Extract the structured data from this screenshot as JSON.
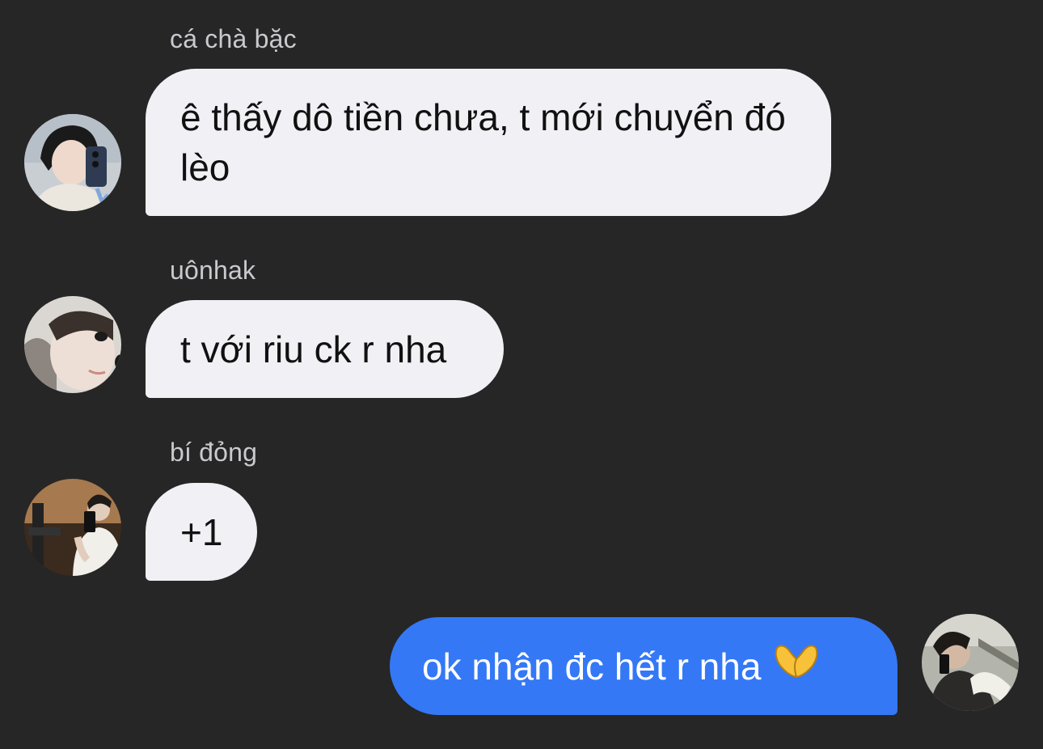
{
  "messages": [
    {
      "sender": "cá chà bặc",
      "text": "ê thấy dô tiền chưa, t mới chuyển đó lèo",
      "direction": "incoming"
    },
    {
      "sender": "uônhak",
      "text": "t với riu ck r nha",
      "direction": "incoming"
    },
    {
      "sender": "bí đỏng",
      "text": "+1",
      "direction": "incoming"
    },
    {
      "sender": "",
      "text": "ok nhận đc hết r nha",
      "emoji": "heart-hands-emoji",
      "direction": "outgoing"
    }
  ],
  "colors": {
    "background": "#262626",
    "incoming_bubble": "#f0f0f5",
    "outgoing_bubble": "#3478f6",
    "sender_name": "#c9c9ce"
  }
}
